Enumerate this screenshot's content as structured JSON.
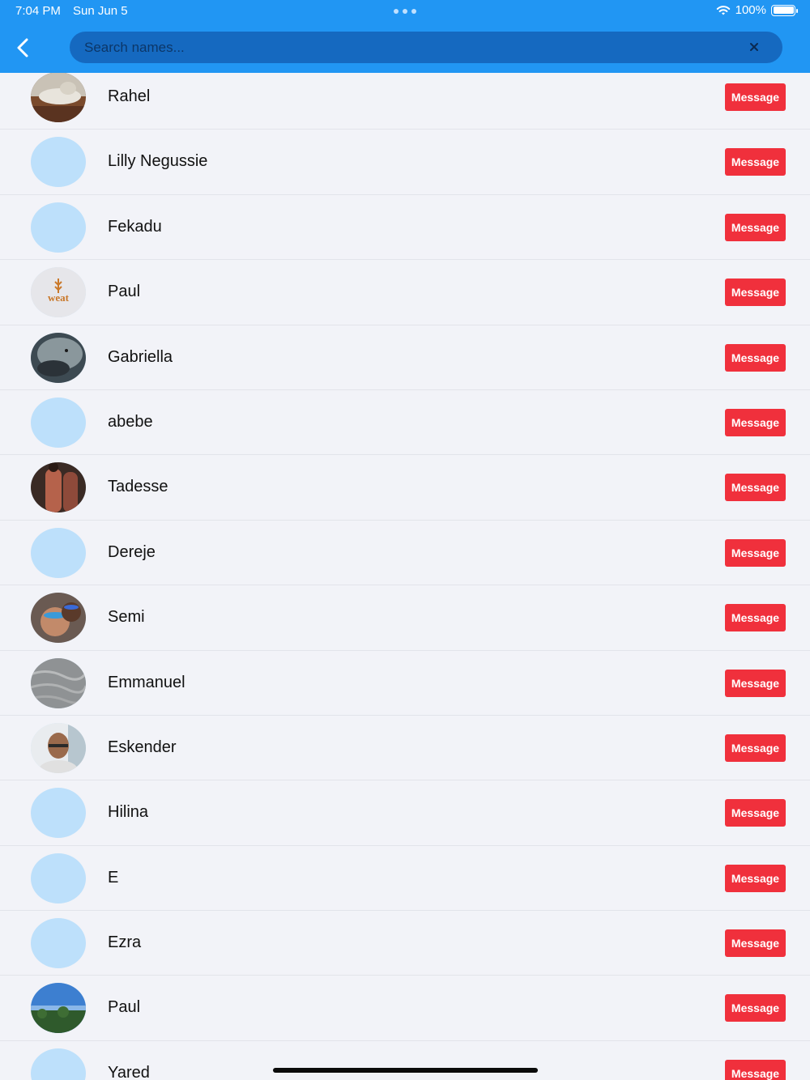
{
  "status_bar": {
    "time": "7:04 PM",
    "date": "Sun Jun 5",
    "battery": "100%"
  },
  "search": {
    "placeholder": "Search names...",
    "value": ""
  },
  "colors": {
    "header": "#2196f3",
    "search_bg": "#1569c0",
    "button": "#f0303c",
    "avatar_placeholder": "#bde0fb"
  },
  "contacts": [
    {
      "name": "Rahel",
      "button": "Message",
      "avatar": "photo-cat"
    },
    {
      "name": "Lilly Negussie",
      "button": "Message",
      "avatar": "placeholder"
    },
    {
      "name": "Fekadu",
      "button": "Message",
      "avatar": "placeholder"
    },
    {
      "name": "Paul",
      "button": "Message",
      "avatar": "logo-weat",
      "avatar_text": "weat"
    },
    {
      "name": "Gabriella",
      "button": "Message",
      "avatar": "photo-seal"
    },
    {
      "name": "abebe",
      "button": "Message",
      "avatar": "placeholder"
    },
    {
      "name": "Tadesse",
      "button": "Message",
      "avatar": "photo-people"
    },
    {
      "name": "Dereje",
      "button": "Message",
      "avatar": "placeholder"
    },
    {
      "name": "Semi",
      "button": "Message",
      "avatar": "photo-selfie"
    },
    {
      "name": "Emmanuel",
      "button": "Message",
      "avatar": "photo-sand"
    },
    {
      "name": "Eskender",
      "button": "Message",
      "avatar": "photo-man"
    },
    {
      "name": "Hilina",
      "button": "Message",
      "avatar": "placeholder"
    },
    {
      "name": "E",
      "button": "Message",
      "avatar": "placeholder"
    },
    {
      "name": "Ezra",
      "button": "Message",
      "avatar": "placeholder"
    },
    {
      "name": "Paul",
      "button": "Message",
      "avatar": "photo-sky"
    },
    {
      "name": "Yared",
      "button": "Message",
      "avatar": "placeholder"
    }
  ]
}
